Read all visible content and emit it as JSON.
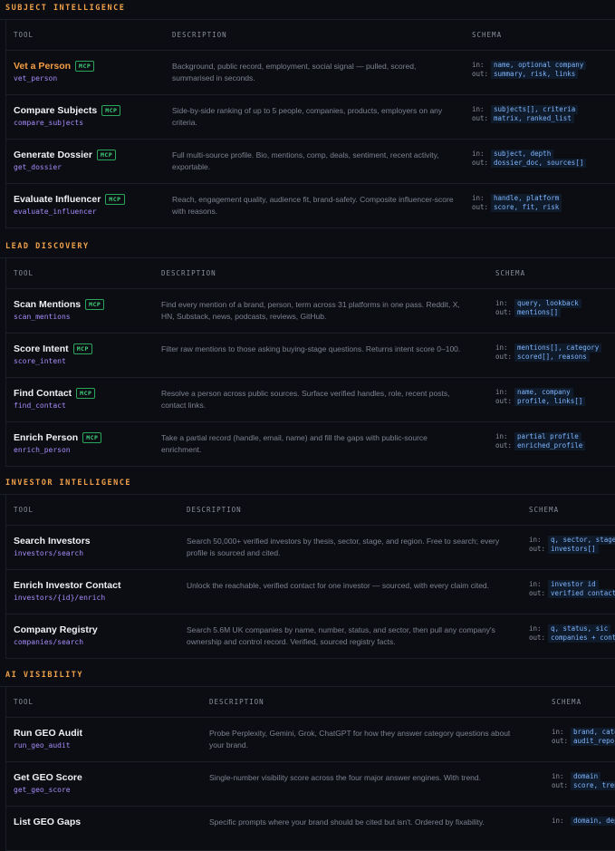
{
  "headers": {
    "tool": "TOOL",
    "description": "DESCRIPTION",
    "schema": "SCHEMA"
  },
  "mcp_label": "MCP",
  "schema_in_label": "in:",
  "schema_out_label": "out:",
  "sections": [
    {
      "title": "SUBJECT INTELLIGENCE",
      "rows": [
        {
          "name": "Vet a Person",
          "id": "vet_person",
          "desc": "Background, public record, employment, social signal — pulled, scored, summarised in seconds.",
          "in": "name, optional company",
          "out": "summary, risk, links"
        },
        {
          "name": "Compare Subjects",
          "id": "compare_subjects",
          "desc": "Side-by-side ranking of up to 5 people, companies, products, employers on any criteria.",
          "in": "subjects[], criteria",
          "out": "matrix, ranked_list"
        },
        {
          "name": "Generate Dossier",
          "id": "get_dossier",
          "desc": "Full multi-source profile. Bio, mentions, comp, deals, sentiment, recent activity, exportable.",
          "in": "subject, depth",
          "out": "dossier_doc, sources[]"
        },
        {
          "name": "Evaluate Influencer",
          "id": "evaluate_influencer",
          "desc": "Reach, engagement quality, audience fit, brand-safety. Composite influencer-score with reasons.",
          "in": "handle, platform",
          "out": "score, fit, risk"
        }
      ]
    },
    {
      "title": "LEAD DISCOVERY",
      "rows": [
        {
          "name": "Scan Mentions",
          "id": "scan_mentions",
          "desc": "Find every mention of a brand, person, term across 31 platforms in one pass. Reddit, X, HN, Substack, news, podcasts, reviews, GitHub.",
          "in": "query, lookback",
          "out": "mentions[]"
        },
        {
          "name": "Score Intent",
          "id": "score_intent",
          "desc": "Filter raw mentions to those asking buying-stage questions. Returns intent score 0–100.",
          "in": "mentions[], category",
          "out": "scored[], reasons"
        },
        {
          "name": "Find Contact",
          "id": "find_contact",
          "desc": "Resolve a person across public sources. Surface verified handles, role, recent posts, contact links.",
          "in": "name, company",
          "out": "profile, links[]"
        },
        {
          "name": "Enrich Person",
          "id": "enrich_person",
          "desc": "Take a partial record (handle, email, name) and fill the gaps with public-source enrichment.",
          "in": "partial profile",
          "out": "enriched_profile"
        }
      ]
    },
    {
      "title": "INVESTOR INTELLIGENCE",
      "rows": [
        {
          "name": "Search Investors",
          "id": "investors/search",
          "desc": "Search 50,000+ verified investors by thesis, sector, stage, and region. Free to search; every profile is sourced and cited.",
          "in": "q, sector, stage,",
          "out": "investors[]"
        },
        {
          "name": "Enrich Investor Contact",
          "id": "investors/{id}/enrich",
          "desc": "Unlock the reachable, verified contact for one investor — sourced, with every claim cited.",
          "in": "investor id",
          "out": "verified contact"
        },
        {
          "name": "Company Registry",
          "id": "companies/search",
          "desc": "Search 5.6M UK companies by name, number, status, and sector, then pull any company's ownership and control record. Verified, sourced registry facts.",
          "in": "q, status, sic",
          "out": "companies + contr"
        }
      ]
    },
    {
      "title": "AI VISIBILITY",
      "rows": [
        {
          "name": "Run GEO Audit",
          "id": "run_geo_audit",
          "desc": "Probe Perplexity, Gemini, Grok, ChatGPT for how they answer category questions about your brand.",
          "in": "brand, catego",
          "out": "audit_report"
        },
        {
          "name": "Get GEO Score",
          "id": "get_geo_score",
          "desc": "Single-number visibility score across the four major answer engines. With trend.",
          "in": "domain",
          "out": "score, tren"
        },
        {
          "name": "List GEO Gaps",
          "id": "",
          "desc": "Specific prompts where your brand should be cited but isn't. Ordered by fixability.",
          "in": "domain, dept",
          "out": ""
        }
      ]
    }
  ]
}
